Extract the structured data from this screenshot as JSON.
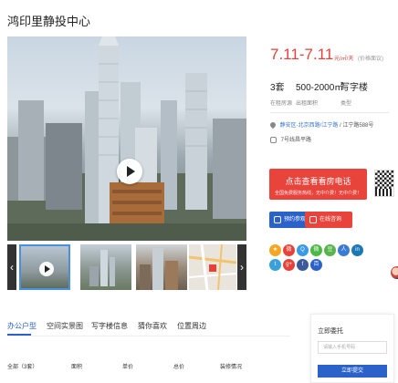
{
  "page": {
    "title": "鸿印里静投中心"
  },
  "gallery": {
    "prev": "‹",
    "next": "›"
  },
  "listing": {
    "price": "7.11-7.11",
    "price_unit": "元/㎡/天",
    "price_note": "(价格面议)",
    "stats": [
      {
        "value": "3套",
        "label": "在租房源"
      },
      {
        "value": "500-2000㎡",
        "label": "出租面积"
      },
      {
        "value": "写字楼",
        "label": "类型"
      }
    ],
    "address_district": "静安区-北京西路/江宁路",
    "address_sep": "/",
    "address_detail": "江宁路588号",
    "metro": "7号线昌平路"
  },
  "actions": {
    "call_main": "点击查看看房电话",
    "call_sub": "全国免费服务热线，无中介费！无中介费！",
    "appointment": "预约参观",
    "chat": "在线咨询"
  },
  "share": {
    "icons": [
      {
        "name": "qzone-icon",
        "color": "#f5a623",
        "glyph": "★"
      },
      {
        "name": "weibo-icon",
        "color": "#e6423a",
        "glyph": "微"
      },
      {
        "name": "qq-icon",
        "color": "#3a9ae8",
        "glyph": "Q"
      },
      {
        "name": "wechat-icon",
        "color": "#4cb848",
        "glyph": "微"
      },
      {
        "name": "douban-icon",
        "color": "#56b44a",
        "glyph": "豆"
      },
      {
        "name": "renren-icon",
        "color": "#3a7bd5",
        "glyph": "人"
      },
      {
        "name": "linkedin-icon",
        "color": "#1b78b5",
        "glyph": "in"
      },
      {
        "name": "twitter-icon",
        "color": "#38a1d9",
        "glyph": "t"
      },
      {
        "name": "googleplus-icon",
        "color": "#e6423a",
        "glyph": "g+"
      },
      {
        "name": "facebook-icon",
        "color": "#3b5a9a",
        "glyph": "f"
      },
      {
        "name": "baidu-icon",
        "color": "#2a62c9",
        "glyph": "百"
      }
    ]
  },
  "tabs": [
    "办公户型",
    "空间实景图",
    "写字楼信息",
    "猜你喜欢",
    "位置周边"
  ],
  "table": {
    "headers": [
      "全部（3套）",
      "面积",
      "单价",
      "总价",
      "装修情况"
    ]
  },
  "side_panel": {
    "title": "立即委托",
    "input_placeholder": "请输入手机号码",
    "submit": "立即提交"
  }
}
